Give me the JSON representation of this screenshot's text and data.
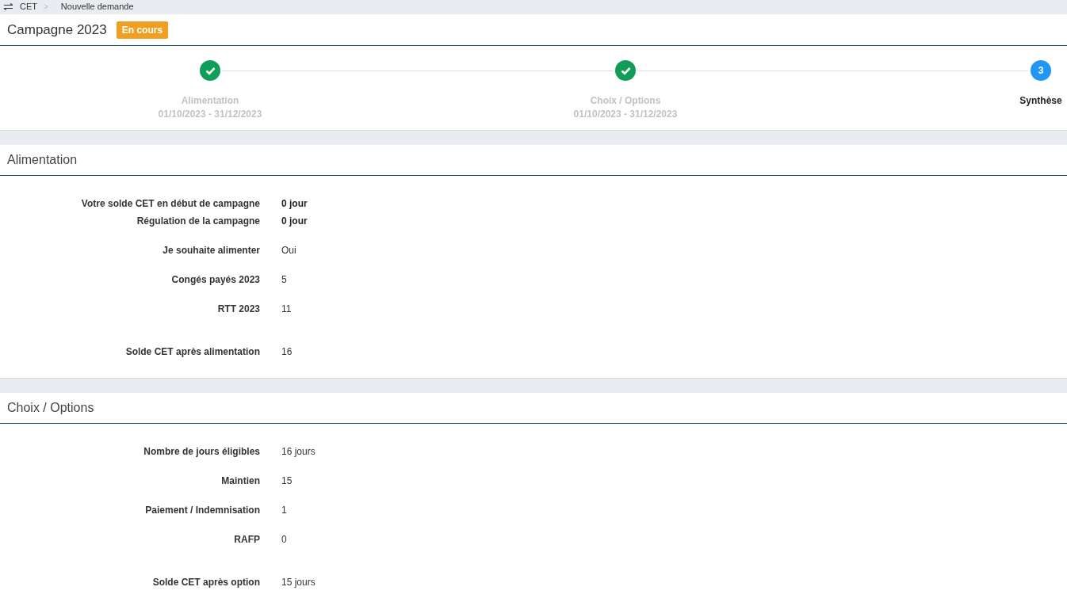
{
  "breadcrumb": {
    "items": [
      "CET",
      "Nouvelle demande"
    ],
    "separator": ">"
  },
  "campaign": {
    "title": "Campagne 2023",
    "badge": "En cours"
  },
  "steps": [
    {
      "done": true,
      "label": "Alimentation",
      "dates": "01/10/2023 - 31/12/2023"
    },
    {
      "done": true,
      "label": "Choix / Options",
      "dates": "01/10/2023 - 31/12/2023"
    },
    {
      "done": false,
      "number": "3",
      "label": "Synthèse"
    }
  ],
  "sections": [
    {
      "title": "Alimentation",
      "groups": [
        {
          "kind": "normal",
          "rows": [
            {
              "label": "Votre solde CET en début de campagne",
              "value": "0 jour",
              "emphasized": true
            },
            {
              "label": "Régulation de la campagne",
              "value": "0 jour",
              "emphasized": true
            }
          ]
        },
        {
          "kind": "normal",
          "rows": [
            {
              "label": "Je souhaite alimenter",
              "value": "Oui",
              "emphasized": false
            }
          ]
        },
        {
          "kind": "normal",
          "rows": [
            {
              "label": "Congés payés 2023",
              "value": "5",
              "emphasized": false
            }
          ]
        },
        {
          "kind": "normal",
          "rows": [
            {
              "label": "RTT 2023",
              "value": "11",
              "emphasized": false
            }
          ]
        },
        {
          "kind": "total",
          "rows": [
            {
              "label": "Solde CET après alimentation",
              "value": "16",
              "emphasized": false
            }
          ]
        }
      ]
    },
    {
      "title": "Choix / Options",
      "groups": [
        {
          "kind": "normal",
          "rows": [
            {
              "label": "Nombre de jours éligibles",
              "value": "16 jours",
              "emphasized": false
            }
          ]
        },
        {
          "kind": "normal",
          "rows": [
            {
              "label": "Maintien",
              "value": "15",
              "emphasized": false
            }
          ]
        },
        {
          "kind": "normal",
          "rows": [
            {
              "label": "Paiement / Indemnisation",
              "value": "1",
              "emphasized": false
            }
          ]
        },
        {
          "kind": "normal",
          "rows": [
            {
              "label": "RAFP",
              "value": "0",
              "emphasized": false
            }
          ]
        },
        {
          "kind": "total",
          "rows": [
            {
              "label": "Solde CET après option",
              "value": "15 jours",
              "emphasized": false
            }
          ]
        }
      ]
    }
  ]
}
